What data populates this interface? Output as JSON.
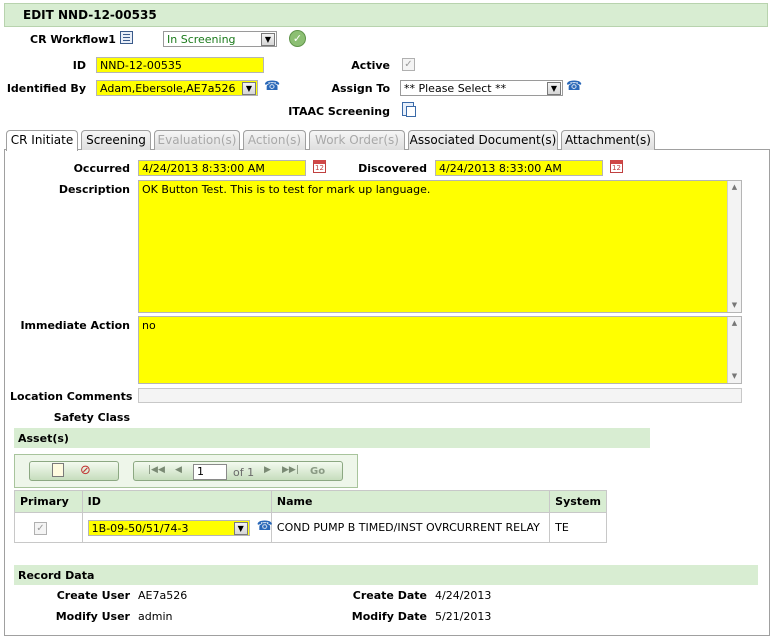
{
  "header": {
    "title": "EDIT NND-12-00535"
  },
  "workflow": {
    "label": "CR Workflow1",
    "status_value": "In Screening"
  },
  "form": {
    "id_label": "ID",
    "id_value": "NND-12-00535",
    "active_label": "Active",
    "identified_by_label": "Identified By",
    "identified_by_value": "Adam,Ebersole,AE7a526",
    "assign_to_label": "Assign To",
    "assign_to_value": "** Please Select **",
    "itaac_label": "ITAAC Screening"
  },
  "tabs": [
    {
      "label": "CR Initiate",
      "state": "active"
    },
    {
      "label": "Screening",
      "state": "enabled"
    },
    {
      "label": "Evaluation(s)",
      "state": "disabled"
    },
    {
      "label": "Action(s)",
      "state": "disabled"
    },
    {
      "label": "Work Order(s)",
      "state": "disabled"
    },
    {
      "label": "Associated Document(s)",
      "state": "enabled"
    },
    {
      "label": "Attachment(s)",
      "state": "enabled"
    }
  ],
  "initiate": {
    "occurred_label": "Occurred",
    "occurred_value": "4/24/2013 8:33:00 AM",
    "discovered_label": "Discovered",
    "discovered_value": "4/24/2013 8:33:00 AM",
    "description_label": "Description",
    "description_value": "OK Button Test. This is to test for mark up language.",
    "immediate_action_label": "Immediate Action",
    "immediate_action_value": "no",
    "location_comments_label": "Location Comments",
    "safety_class_label": "Safety Class"
  },
  "assets": {
    "section_title": "Asset(s)",
    "pager": {
      "page_value": "1",
      "of_label": "of 1",
      "go_label": "Go"
    },
    "columns": [
      "Primary",
      "ID",
      "Name",
      "System"
    ],
    "rows": [
      {
        "id": "1B-09-50/51/74-3",
        "name": "COND PUMP B TIMED/INST OVRCURRENT RELAY",
        "system": "TE"
      }
    ]
  },
  "record": {
    "section_title": "Record Data",
    "create_user_label": "Create User",
    "create_user_value": "AE7a526",
    "create_date_label": "Create Date",
    "create_date_value": "4/24/2013",
    "modify_user_label": "Modify User",
    "modify_user_value": "admin",
    "modify_date_label": "Modify Date",
    "modify_date_value": "5/21/2013"
  },
  "colors": {
    "field_yellow": "#ffff00",
    "section_green": "#d8edd2",
    "header_green": "#d8edd2"
  }
}
